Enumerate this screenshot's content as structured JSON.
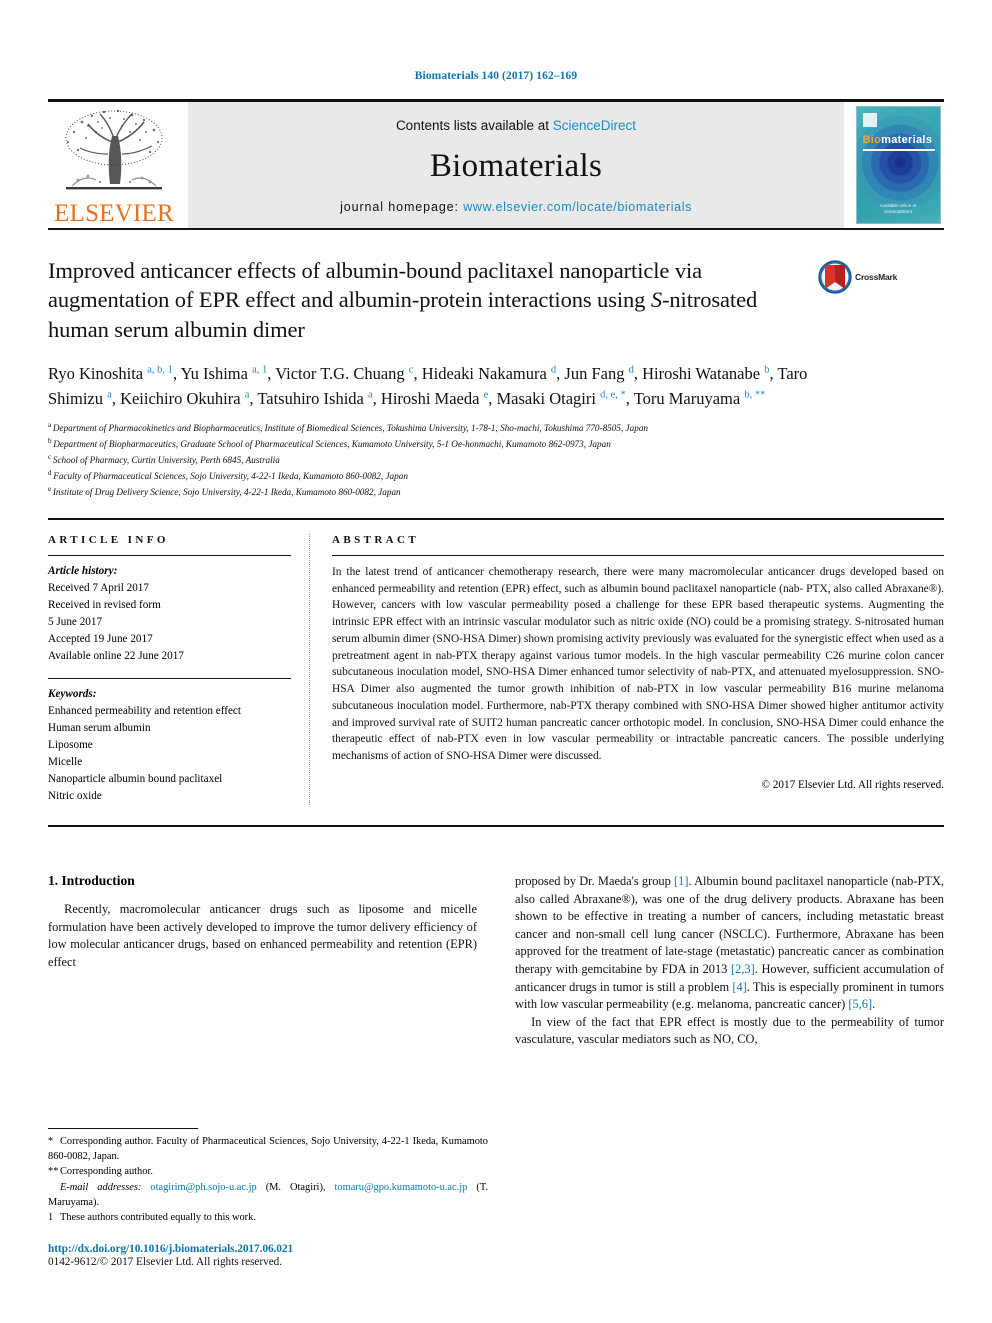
{
  "running_head": "Biomaterials 140 (2017) 162–169",
  "masthead": {
    "publisher": "ELSEVIER",
    "contents_prefix": "Contents lists available at ",
    "contents_link": "ScienceDirect",
    "journal_name": "Biomaterials",
    "homepage_prefix": "journal homepage: ",
    "homepage_url": "www.elsevier.com/locate/biomaterials",
    "cover": {
      "title_accent": "Bio",
      "title_rest": "materials",
      "footer_line1": "Available online at",
      "footer_line2": "ScienceDirect"
    }
  },
  "article": {
    "title_line1": "Improved anticancer effects of albumin-bound paclitaxel nanoparticle",
    "title_line2": "via augmentation of EPR effect and albumin-protein interactions using",
    "title_line3_italic": "S",
    "title_line3_rest": "-nitrosated human serum albumin dimer",
    "crossmark_label": "CrossMark",
    "authors": [
      {
        "name": "Ryo Kinoshita",
        "sup": "a, b, 1",
        "sep": ", "
      },
      {
        "name": "Yu Ishima",
        "sup": "a, 1",
        "sep": ", "
      },
      {
        "name": "Victor T.G. Chuang",
        "sup": "c",
        "sep": ", "
      },
      {
        "name": "Hideaki Nakamura",
        "sup": "d",
        "sep": ", "
      },
      {
        "name": "Jun Fang",
        "sup": "d",
        "sep": ", "
      },
      {
        "name": "Hiroshi Watanabe",
        "sup": "b",
        "sep": ", "
      },
      {
        "name": "Taro Shimizu",
        "sup": "a",
        "sep": ", "
      },
      {
        "name": "Keiichiro Okuhira",
        "sup": "a",
        "sep": ", "
      },
      {
        "name": "Tatsuhiro Ishida",
        "sup": "a",
        "sep": ", "
      },
      {
        "name": "Hiroshi Maeda",
        "sup": "e",
        "sep": ", "
      },
      {
        "name": "Masaki Otagiri",
        "sup": "d, e, *",
        "sep": ", "
      },
      {
        "name": "Toru Maruyama",
        "sup": "b, **",
        "sep": ""
      }
    ],
    "affiliations": [
      {
        "mark": "a",
        "text": "Department of Pharmacokinetics and Biopharmaceutics, Institute of Biomedical Sciences, Tokushima University, 1-78-1, Sho-machi, Tokushima 770-8505, Japan"
      },
      {
        "mark": "b",
        "text": "Department of Biopharmaceutics, Graduate School of Pharmaceutical Sciences, Kumamoto University, 5-1 Oe-honmachi, Kumamoto 862-0973, Japan"
      },
      {
        "mark": "c",
        "text": "School of Pharmacy, Curtin University, Perth 6845, Australia"
      },
      {
        "mark": "d",
        "text": "Faculty of Pharmaceutical Sciences, Sojo University, 4-22-1 Ikeda, Kumamoto 860-0082, Japan"
      },
      {
        "mark": "e",
        "text": "Institute of Drug Delivery Science, Sojo University, 4-22-1 Ikeda, Kumamoto 860-0082, Japan"
      }
    ]
  },
  "article_info": {
    "heading": "ARTICLE INFO",
    "history_label": "Article history:",
    "history": [
      "Received 7 April 2017",
      "Received in revised form",
      "5 June 2017",
      "Accepted 19 June 2017",
      "Available online 22 June 2017"
    ],
    "keywords_label": "Keywords:",
    "keywords": [
      "Enhanced permeability and retention effect",
      "Human serum albumin",
      "Liposome",
      "Micelle",
      "Nanoparticle albumin bound paclitaxel",
      "Nitric oxide"
    ]
  },
  "abstract": {
    "heading": "ABSTRACT",
    "text": "In the latest trend of anticancer chemotherapy research, there were many macromolecular anticancer drugs developed based on enhanced permeability and retention (EPR) effect, such as albumin bound paclitaxel nanoparticle (nab- PTX, also called Abraxane®). However, cancers with low vascular permeability posed a challenge for these EPR based therapeutic systems. Augmenting the intrinsic EPR effect with an intrinsic vascular modulator such as nitric oxide (NO) could be a promising strategy. S-nitrosated human serum albumin dimer (SNO-HSA Dimer) shown promising activity previously was evaluated for the synergistic effect when used as a pretreatment agent in nab-PTX therapy against various tumor models. In the high vascular permeability C26 murine colon cancer subcutaneous inoculation model, SNO-HSA Dimer enhanced tumor selectivity of nab-PTX, and attenuated myelosuppression. SNO-HSA Dimer also augmented the tumor growth inhibition of nab-PTX in low vascular permeability B16 murine melanoma subcutaneous inoculation model. Furthermore, nab-PTX therapy combined with SNO-HSA Dimer showed higher antitumor activity and improved survival rate of SUIT2 human pancreatic cancer orthotopic model. In conclusion, SNO-HSA Dimer could enhance the therapeutic effect of nab-PTX even in low vascular permeability or intractable pancreatic cancers. The possible underlying mechanisms of action of SNO-HSA Dimer were discussed.",
    "copyright": "© 2017 Elsevier Ltd. All rights reserved."
  },
  "body": {
    "section_number_title": "1. Introduction",
    "left_para": "Recently, macromolecular anticancer drugs such as liposome and micelle formulation have been actively developed to improve the tumor delivery efficiency of low molecular anticancer drugs, based on enhanced permeability and retention (EPR) effect",
    "right_para1_a": "proposed by Dr. Maeda's group ",
    "right_para1_ref1": "[1]",
    "right_para1_b": ". Albumin bound paclitaxel nanoparticle (nab-PTX, also called Abraxane®), was one of the drug delivery products. Abraxane has been shown to be effective in treating a number of cancers, including metastatic breast cancer and non-small cell lung cancer (NSCLC). Furthermore, Abraxane has been approved for the treatment of late-stage (metastatic) pancreatic cancer as combination therapy with gemcitabine by FDA in 2013 ",
    "right_para1_ref2": "[2,3]",
    "right_para1_c": ". However, sufficient accumulation of anticancer drugs in tumor is still a problem ",
    "right_para1_ref3": "[4]",
    "right_para1_d": ". This is especially prominent in tumors with low vascular permeability (e.g. melanoma, pancreatic cancer) ",
    "right_para1_ref4": "[5,6]",
    "right_para1_e": ".",
    "right_para2": "In view of the fact that EPR effect is mostly due to the permeability of tumor vasculature, vascular mediators such as NO, CO,"
  },
  "footnotes": {
    "corresponding1_mark": "*",
    "corresponding1": "Corresponding author. Faculty of Pharmaceutical Sciences, Sojo University, 4-22-1 Ikeda, Kumamoto 860-0082, Japan.",
    "corresponding2_mark": "**",
    "corresponding2": "Corresponding author.",
    "email_label": "E-mail addresses:",
    "email1": "otagirim@ph.sojo-u.ac.jp",
    "email1_owner": "(M. Otagiri)",
    "email2": "tomaru@gpo.kumamoto-u.ac.jp",
    "email2_owner": "(T. Maruyama).",
    "equal_mark": "1",
    "equal_contribution": "These authors contributed equally to this work.",
    "doi": "http://dx.doi.org/10.1016/j.biomaterials.2017.06.021",
    "issn": "0142-9612/© 2017 Elsevier Ltd. All rights reserved."
  },
  "colors": {
    "link_blue": "#0b77ad",
    "sciencedirect_blue": "#1a8ac4",
    "elsevier_orange": "#E9711C",
    "cover_teal": "#2aa8b5"
  }
}
